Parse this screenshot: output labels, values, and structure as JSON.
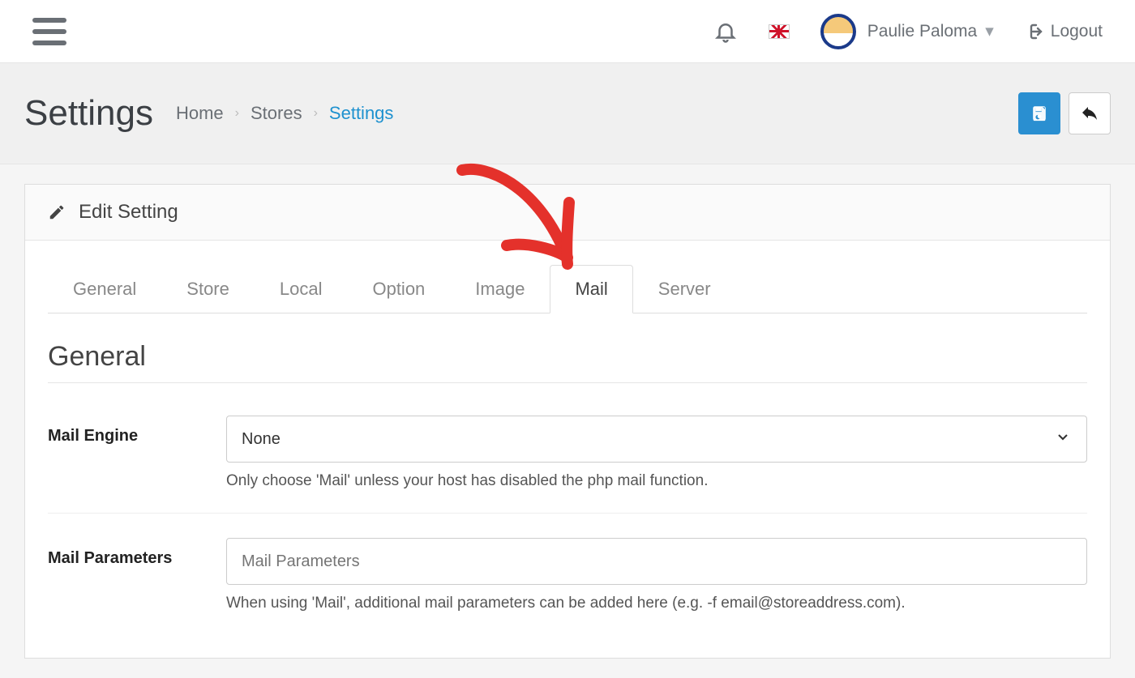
{
  "header": {
    "user_name": "Paulie Paloma",
    "logout_label": "Logout"
  },
  "page": {
    "title": "Settings",
    "breadcrumb": [
      "Home",
      "Stores",
      "Settings"
    ]
  },
  "panel": {
    "heading": "Edit Setting",
    "tabs": [
      "General",
      "Store",
      "Local",
      "Option",
      "Image",
      "Mail",
      "Server"
    ],
    "active_tab_index": 5,
    "section_title": "General"
  },
  "fields": {
    "mail_engine": {
      "label": "Mail Engine",
      "value": "None",
      "help": "Only choose 'Mail' unless your host has disabled the php mail function."
    },
    "mail_parameters": {
      "label": "Mail Parameters",
      "placeholder": "Mail Parameters",
      "value": "",
      "help": "When using 'Mail', additional mail parameters can be added here (e.g. -f email@storeaddress.com)."
    }
  }
}
